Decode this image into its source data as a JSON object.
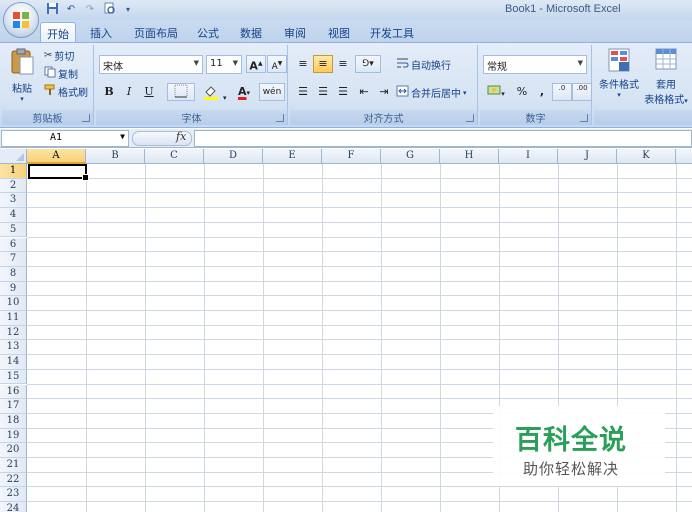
{
  "window": {
    "title": "Book1 - Microsoft Excel"
  },
  "quick_access": {
    "icons": [
      "save-icon",
      "undo-icon",
      "redo-icon",
      "print-preview-icon",
      "customize-icon"
    ]
  },
  "tabs": [
    {
      "label": "开始",
      "active": true
    },
    {
      "label": "插入"
    },
    {
      "label": "页面布局"
    },
    {
      "label": "公式"
    },
    {
      "label": "数据"
    },
    {
      "label": "审阅"
    },
    {
      "label": "视图"
    },
    {
      "label": "开发工具"
    }
  ],
  "ribbon": {
    "clipboard": {
      "label": "剪贴板",
      "paste": "粘贴",
      "cut": "剪切",
      "copy": "复制",
      "format_painter": "格式刷"
    },
    "font": {
      "label": "字体",
      "font_name": "宋体",
      "font_size": "11",
      "bold": "B",
      "italic": "I",
      "underline": "U",
      "grow": "A",
      "shrink": "A",
      "color_a": "A",
      "phonetic": "wén"
    },
    "alignment": {
      "label": "对齐方式",
      "wrap_text": "自动换行",
      "merge_center": "合并后居中"
    },
    "number": {
      "label": "数字",
      "format": "常规",
      "percent": "%",
      "comma": ",",
      "inc_decimal": ".0",
      "dec_decimal": ".00"
    },
    "styles": {
      "conditional_format": "条件格式",
      "table_format_1": "套用",
      "table_format_2": "表格格式"
    }
  },
  "formula_bar": {
    "name_box": "A1",
    "fx": "fx",
    "formula": ""
  },
  "sheet": {
    "columns": [
      "A",
      "B",
      "C",
      "D",
      "E",
      "F",
      "G",
      "H",
      "I",
      "J",
      "K"
    ],
    "rows": [
      "1",
      "2",
      "3",
      "4",
      "5",
      "6",
      "7",
      "8",
      "9",
      "10",
      "11",
      "12",
      "13",
      "14",
      "15",
      "16",
      "17",
      "18",
      "19",
      "20",
      "21",
      "22",
      "23",
      "24"
    ],
    "selected_cell": "A1"
  },
  "watermark": {
    "title": "百科全说",
    "subtitle": "助你轻松解决"
  },
  "colors": {
    "accent_green": "#2a9f59",
    "ribbon_blue": "#15428b",
    "selection_orange": "#f8d17a"
  }
}
